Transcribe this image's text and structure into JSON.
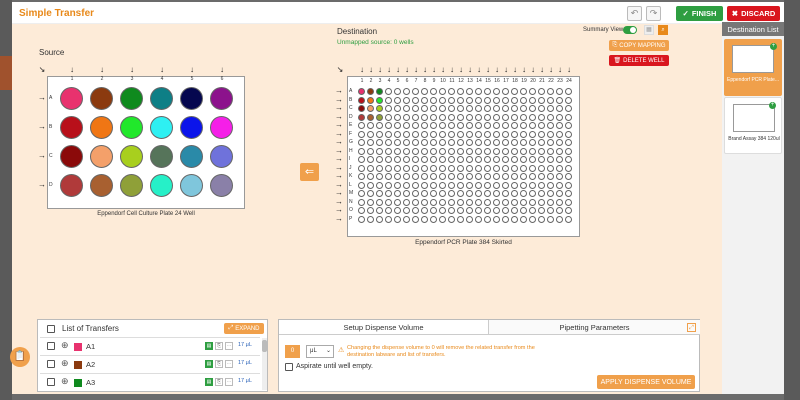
{
  "header": {
    "title": "Simple Transfer",
    "finish_label": "FINISH",
    "discard_label": "DISCARD",
    "accent": "#e8891a"
  },
  "source": {
    "label": "Source",
    "plate_name": "Eppendorf Cell Culture Plate 24 Well",
    "columns": [
      "1",
      "2",
      "3",
      "4",
      "5",
      "6"
    ],
    "rows": [
      "A",
      "B",
      "C",
      "D"
    ],
    "well_colors": [
      [
        "#e8326e",
        "#8b3a0f",
        "#0f8a1e",
        "#0e7f86",
        "#05074f",
        "#8c128c"
      ],
      [
        "#b8101a",
        "#f07614",
        "#21e82b",
        "#2ef0f2",
        "#0b14ea",
        "#f51fe8"
      ],
      [
        "#8b0a0a",
        "#f4a06a",
        "#a8cf1e",
        "#56745a",
        "#2a8aa8",
        "#6f72db"
      ],
      [
        "#b03a3a",
        "#a86030",
        "#8fa038",
        "#26f0c8",
        "#7fc6dc",
        "#8a80a8"
      ]
    ]
  },
  "destination": {
    "label": "Destination",
    "unmapped": "Unmapped source: 0 wells",
    "summary_view_label": "Summary View",
    "copy_mapping_label": "COPY MAPPING",
    "delete_well_label": "DELETE WELL",
    "plate_name": "Eppendorf PCR Plate 384 Skirted",
    "columns": [
      "1",
      "2",
      "3",
      "4",
      "5",
      "6",
      "7",
      "8",
      "9",
      "10",
      "11",
      "12",
      "13",
      "14",
      "15",
      "16",
      "17",
      "18",
      "19",
      "20",
      "21",
      "22",
      "23",
      "24"
    ],
    "rows": [
      "A",
      "B",
      "C",
      "D",
      "E",
      "F",
      "G",
      "H",
      "I",
      "J",
      "K",
      "L",
      "M",
      "N",
      "O",
      "P"
    ],
    "filled": [
      [
        "#e8326e",
        "#8b3a0f",
        "#0f8a1e"
      ],
      [
        "#b8101a",
        "#f07614",
        "#21e82b"
      ],
      [
        "#8b0a0a",
        "#f4a06a",
        "#a8cf1e"
      ],
      [
        "#b03a3a",
        "#a86030",
        "#8fa038"
      ]
    ]
  },
  "destination_list": {
    "title": "Destination List",
    "items": [
      {
        "name": "Eppendorf PCR Plate..."
      },
      {
        "name": "Brand Assay 384 120ul"
      }
    ]
  },
  "transfers": {
    "title": "List of Transfers",
    "expand_label": "EXPAND",
    "rows": [
      {
        "well": "A1",
        "color": "#e8326e",
        "volume": "17 μL"
      },
      {
        "well": "A2",
        "color": "#8b3a0f",
        "volume": "17 μL"
      },
      {
        "well": "A3",
        "color": "#0f8a1e",
        "volume": "17 μL"
      }
    ]
  },
  "dispense": {
    "tab_setup": "Setup Dispense Volume",
    "tab_pipetting": "Pipetting Parameters",
    "volume_value": "0",
    "unit": "μL",
    "warning": "Changing the dispense volume to 0 will remove the related transfer from the destination labware and list of transfers.",
    "aspirate_label": "Aspirate until well empty.",
    "apply_label": "APPLY DISPENSE VOLUME"
  }
}
